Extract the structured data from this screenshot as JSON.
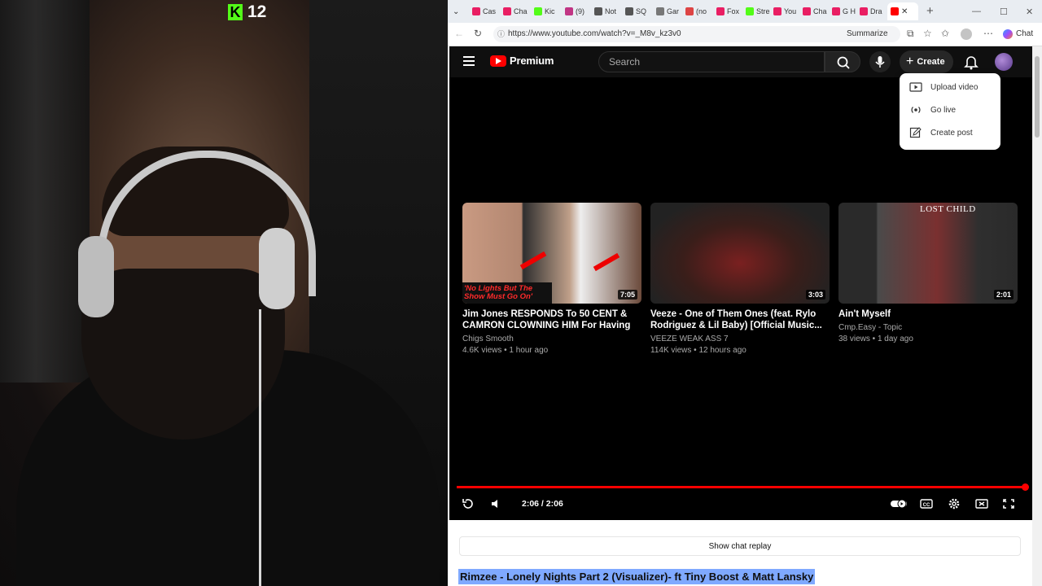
{
  "stream_overlay": {
    "platform_icon": "kick-logo",
    "viewer_count": "12"
  },
  "browser": {
    "tabs": [
      "Cas",
      "Cha",
      "Kic",
      "(9)",
      "Not",
      "SQ",
      "Gar",
      "(no",
      "Fox",
      "Stre",
      "You",
      "Cha",
      "G H",
      "Dra"
    ],
    "url": "https://www.youtube.com/watch?v=_M8v_kz3v0",
    "summarize_label": "Summarize",
    "chat_label": "Chat",
    "new_tab_symbol": "+"
  },
  "youtube": {
    "logo_text": "Premium",
    "search_placeholder": "Search",
    "create_label": "Create",
    "create_menu": [
      {
        "label": "Upload video",
        "icon": "upload-video-icon"
      },
      {
        "label": "Go live",
        "icon": "go-live-icon"
      },
      {
        "label": "Create post",
        "icon": "create-post-icon"
      }
    ],
    "end_screen": [
      {
        "title": "Jim Jones RESPONDS To 50 CENT & CAMRON CLOWNING HIM For Having N...",
        "channel": "Chigs Smooth",
        "meta": "4.6K views • 1 hour ago",
        "duration": "7:05",
        "thumb_caption": "'No Lights But The Show Must Go On'"
      },
      {
        "title": "Veeze - One of Them Ones (feat. Rylo Rodriguez & Lil Baby) [Official Music...",
        "channel": "VEEZE WEAK ASS 7",
        "meta": "114K views • 12 hours ago",
        "duration": "3:03"
      },
      {
        "title": "Ain't Myself",
        "channel": "Cmp.Easy - Topic",
        "meta": "38 views • 1 day ago",
        "duration": "2:01",
        "thumb_caption": "LOST CHILD"
      }
    ],
    "player": {
      "time": "2:06 / 2:06",
      "progress": 1.0
    },
    "show_chat_replay": "Show chat replay",
    "video_title": "Rimzee - Lonely Nights Part 2 (Visualizer)- ft Tiny Boost & Matt Lansky"
  },
  "colors": {
    "youtube_red": "#ff0000",
    "kick_green": "#53fc18",
    "selection": "#7fa9ff"
  }
}
